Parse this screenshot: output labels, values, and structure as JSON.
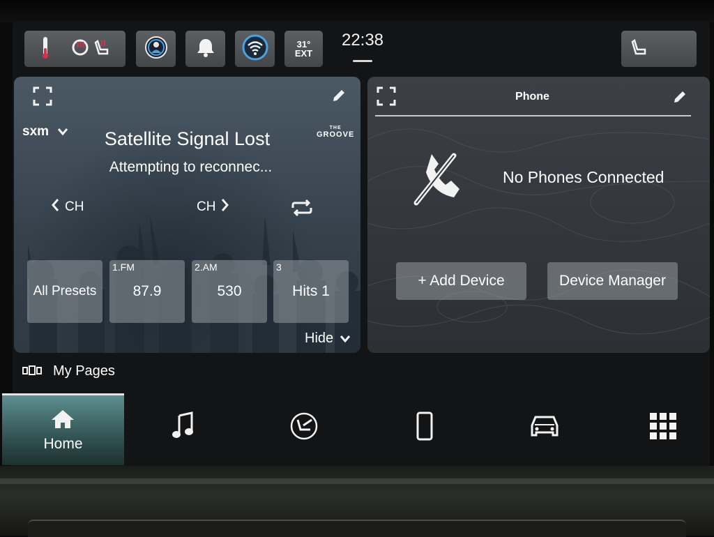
{
  "status_bar": {
    "temp_value": "31°",
    "temp_label": "EXT",
    "clock": "22:38"
  },
  "radio_card": {
    "source": "sxm",
    "channel_logo_top": "THE",
    "channel_logo_main": "GROOVE",
    "title": "Satellite Signal Lost",
    "subtitle": "Attempting to reconnec...",
    "ch_prev_label": "CH",
    "ch_next_label": "CH",
    "all_presets_label": "All Presets",
    "presets": [
      {
        "number": "1.FM",
        "value": "87.9"
      },
      {
        "number": "2.AM",
        "value": "530"
      },
      {
        "number": "3",
        "value": "Hits 1"
      }
    ],
    "hide_label": "Hide"
  },
  "phone_card": {
    "title": "Phone",
    "status": "No Phones Connected",
    "add_device_label": "+ Add Device",
    "device_manager_label": "Device Manager"
  },
  "my_pages_label": "My Pages",
  "nav": {
    "home_label": "Home"
  },
  "colors": {
    "accent_blue": "#4aa3e0",
    "heated_red": "#d9304a",
    "home_tab": "#4d7f80"
  }
}
